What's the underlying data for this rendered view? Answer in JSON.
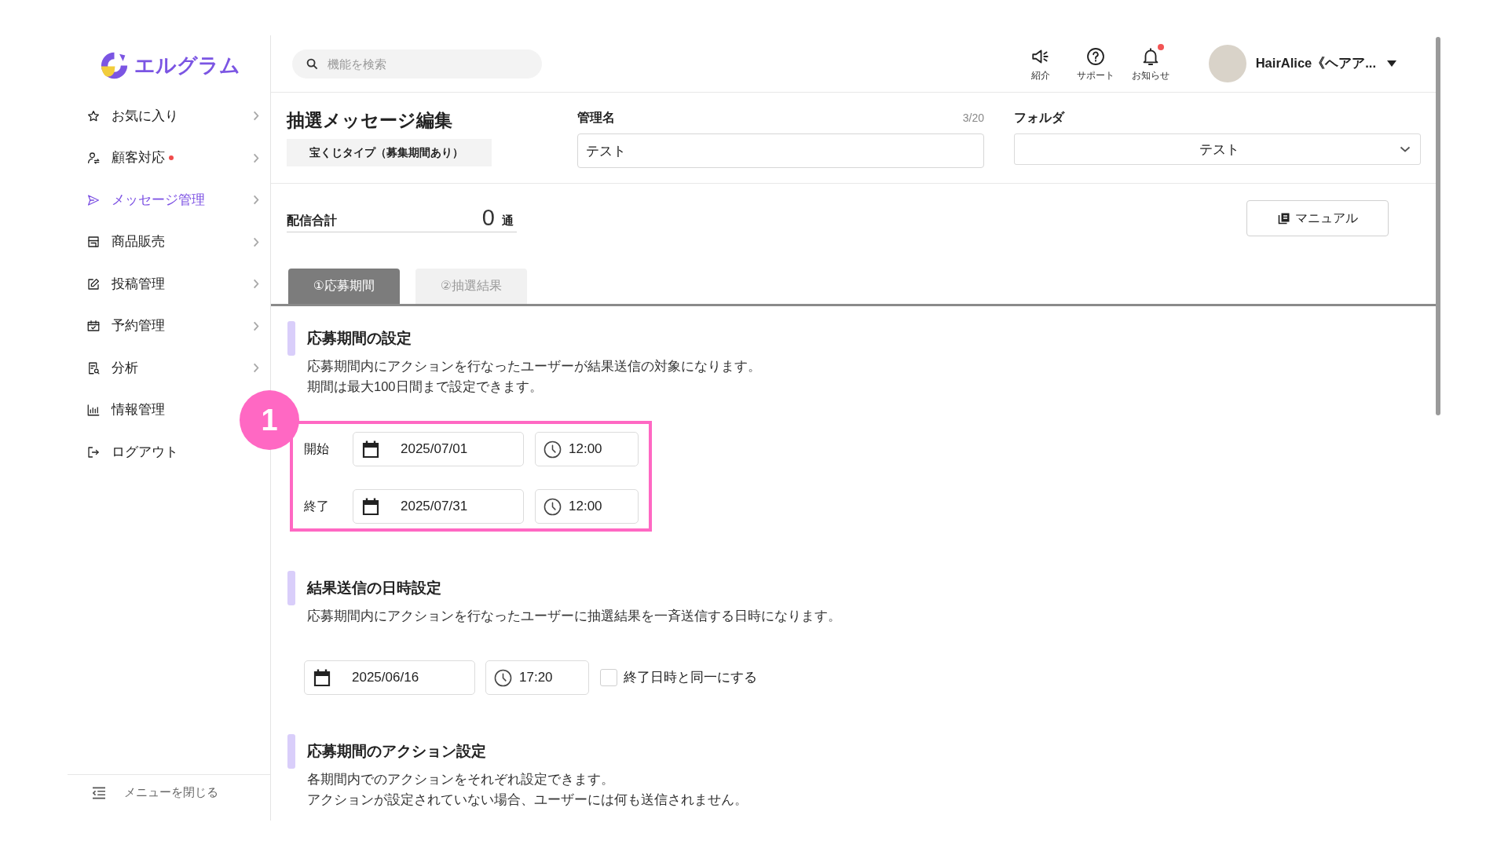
{
  "logo": {
    "text": "エルグラム"
  },
  "sidebar": {
    "items": [
      {
        "label": "お気に入り",
        "selected": false,
        "alert": false,
        "has_submenu": true
      },
      {
        "label": "顧客対応",
        "selected": false,
        "alert": true,
        "has_submenu": true
      },
      {
        "label": "メッセージ管理",
        "selected": true,
        "alert": false,
        "has_submenu": true
      },
      {
        "label": "商品販売",
        "selected": false,
        "alert": false,
        "has_submenu": true
      },
      {
        "label": "投稿管理",
        "selected": false,
        "alert": false,
        "has_submenu": true
      },
      {
        "label": "予約管理",
        "selected": false,
        "alert": false,
        "has_submenu": true
      },
      {
        "label": "分析",
        "selected": false,
        "alert": false,
        "has_submenu": true
      },
      {
        "label": "情報管理",
        "selected": false,
        "alert": false,
        "has_submenu": false
      },
      {
        "label": "ログアウト",
        "selected": false,
        "alert": false,
        "has_submenu": false
      }
    ],
    "collapse_label": "メニューを閉じる"
  },
  "header": {
    "search": {
      "placeholder": "機能を検索"
    },
    "actions": [
      {
        "label": "紹介",
        "badge": false
      },
      {
        "label": "サポート",
        "badge": false
      },
      {
        "label": "お知らせ",
        "badge": true
      }
    ],
    "user": {
      "name": "HairAlice《ヘアア..."
    }
  },
  "editor": {
    "title": "抽選メッセージ編集",
    "type_badge": "宝くじタイプ（募集期間あり）",
    "name_field": {
      "label": "管理名",
      "counter": "3/20",
      "value": "テスト"
    },
    "folder_field": {
      "label": "フォルダ",
      "value": "テスト"
    },
    "total": {
      "label": "配信合計",
      "count": "0",
      "unit": "通"
    },
    "manual_button": "マニュアル"
  },
  "tabs": [
    {
      "label": "①応募期間",
      "selected": true
    },
    {
      "label": "②抽選結果",
      "selected": false
    }
  ],
  "sections": [
    {
      "kind": "period",
      "title": "応募期間の設定",
      "description": [
        "応募期間内にアクションを行なったユーザーが結果送信の対象になります。",
        "期間は最大100日間まで設定できます。"
      ],
      "highlighted": true,
      "marker": "1",
      "rows": [
        {
          "label": "開始",
          "date": "2025/07/01",
          "time": "12:00"
        },
        {
          "label": "終了",
          "date": "2025/07/31",
          "time": "12:00"
        }
      ]
    },
    {
      "kind": "schedule",
      "title": "結果送信の日時設定",
      "description": [
        "応募期間内にアクションを行なったユーザーに抽選結果を一斉送信する日時になります。"
      ],
      "date": "2025/06/16",
      "time": "17:20",
      "same_as_end": {
        "label": "終了日時と同一にする",
        "checked": false
      }
    },
    {
      "kind": "info",
      "title": "応募期間のアクション設定",
      "description": [
        "各期間内でのアクションをそれぞれ設定できます。",
        "アクションが設定されていない場合、ユーザーには何も送信されません。"
      ]
    }
  ]
}
